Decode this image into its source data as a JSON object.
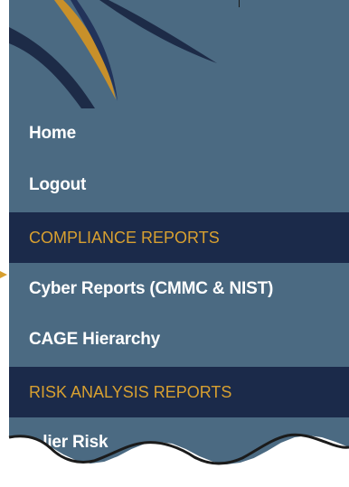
{
  "menu": {
    "items": [
      {
        "label": "Home",
        "type": "link"
      },
      {
        "label": "Logout",
        "type": "link"
      },
      {
        "label": "COMPLIANCE REPORTS",
        "type": "section"
      },
      {
        "label": "Cyber Reports (CMMC & NIST)",
        "type": "link"
      },
      {
        "label": "CAGE Hierarchy",
        "type": "link"
      },
      {
        "label": "RISK ANALYSIS REPORTS",
        "type": "section"
      },
      {
        "label": "...lier Risk",
        "type": "link"
      }
    ]
  },
  "colors": {
    "panel_background": "#4b6a82",
    "section_background": "#1b2a4a",
    "section_text": "#d8a030",
    "link_text": "#ffffff",
    "logo_accent": "#c8902a"
  }
}
